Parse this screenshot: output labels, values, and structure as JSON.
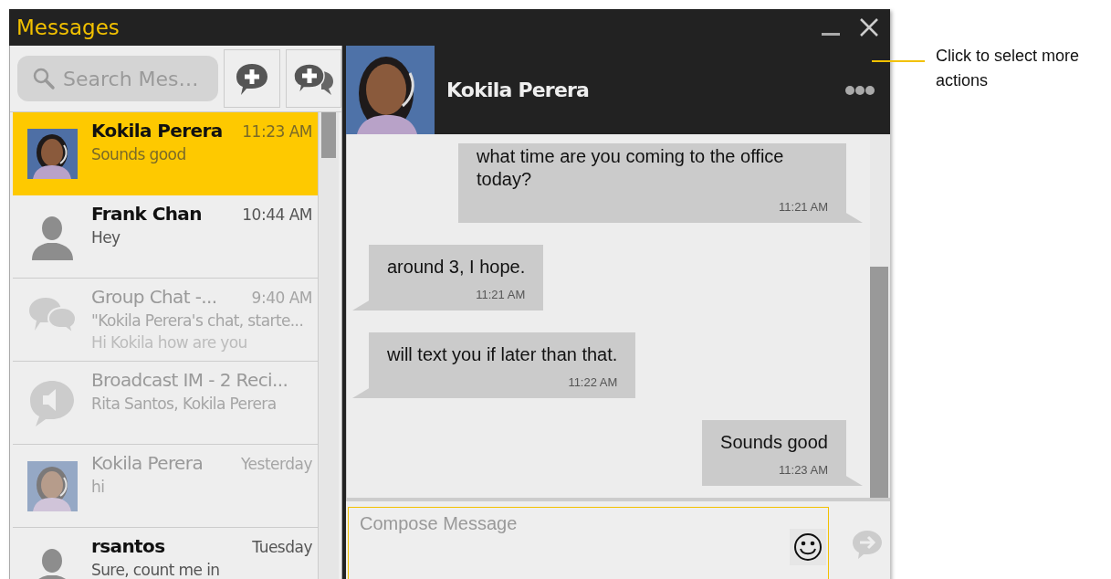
{
  "window": {
    "title": "Messages"
  },
  "search": {
    "placeholder": "Search Mes…"
  },
  "conversations": [
    {
      "name": "Kokila Perera",
      "time": "11:23 AM",
      "lines": [
        "Sounds good"
      ],
      "selected": true,
      "dimmed": false
    },
    {
      "kind": "person",
      "name": "Frank Chan",
      "time": "10:44 AM",
      "lines": [
        "Hey"
      ],
      "selected": false,
      "dimmed": false
    },
    {
      "kind": "group",
      "name": "Group Chat -...",
      "time": "9:40 AM",
      "lines": [
        "\"Kokila Perera's chat, starte...",
        "Hi Kokila how are you"
      ],
      "selected": false,
      "dimmed": true
    },
    {
      "kind": "broadcast",
      "name": "Broadcast IM - 2 Reci...",
      "lines": [
        "Rita Santos, Kokila Perera"
      ],
      "selected": false,
      "dimmed": true
    },
    {
      "name": "Kokila Perera",
      "time": "Yesterday",
      "lines": [
        "hi"
      ],
      "selected": false,
      "dimmed": true
    },
    {
      "kind": "person",
      "name": "rsantos",
      "time": "Tuesday",
      "lines": [
        "Sure, count me in"
      ],
      "selected": false,
      "dimmed": false
    }
  ],
  "chat": {
    "contact": "Kokila Perera",
    "messages": [
      {
        "kind": "sent",
        "text": "what time are you coming to the office today?",
        "time": "11:21 AM"
      },
      {
        "kind": "received",
        "text": "around 3, I hope.",
        "time": "11:21 AM"
      },
      {
        "kind": "received",
        "text": "will text you if later than that.",
        "time": "11:22 AM"
      },
      {
        "kind": "sent",
        "text": "Sounds good",
        "time": "11:23 AM"
      }
    ]
  },
  "compose": {
    "placeholder": "Compose Message"
  },
  "callout": {
    "text": "Click to select more actions"
  }
}
